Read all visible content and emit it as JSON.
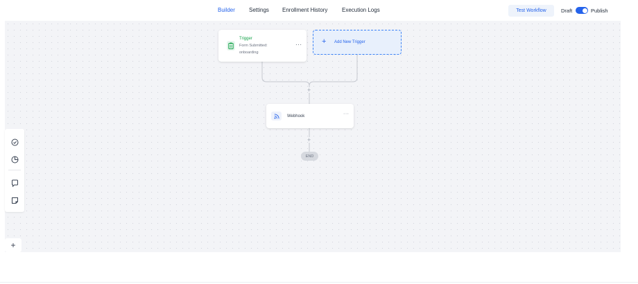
{
  "tabs": {
    "builder": "Builder",
    "settings": "Settings",
    "enrollment": "Enrollment History",
    "execution": "Execution Logs"
  },
  "header": {
    "test_workflow": "Test Workflow",
    "draft": "Draft",
    "publish": "Publish",
    "publish_toggle_on": true
  },
  "trigger_node": {
    "title": "Trigger",
    "subtitle_line1": "Form Submitted:",
    "subtitle_line2": "onboarding",
    "menu": "···",
    "icon": "clipboard-icon"
  },
  "add_trigger": {
    "plus": "+",
    "label": "Add New Trigger"
  },
  "webhook_node": {
    "label": "Webhook",
    "menu": "···",
    "icon": "rss-icon"
  },
  "connectors": {
    "plus_top": "+",
    "plus_bottom": "+",
    "end": "END"
  },
  "toolbar": {
    "add": "+",
    "icons": [
      "check-circle-icon",
      "pie-chart-icon",
      "comment-icon",
      "sticky-note-icon"
    ]
  },
  "colors": {
    "accent": "#2563eb",
    "trigger_green": "#16a34a",
    "canvas_bg": "#f3f4f7"
  }
}
